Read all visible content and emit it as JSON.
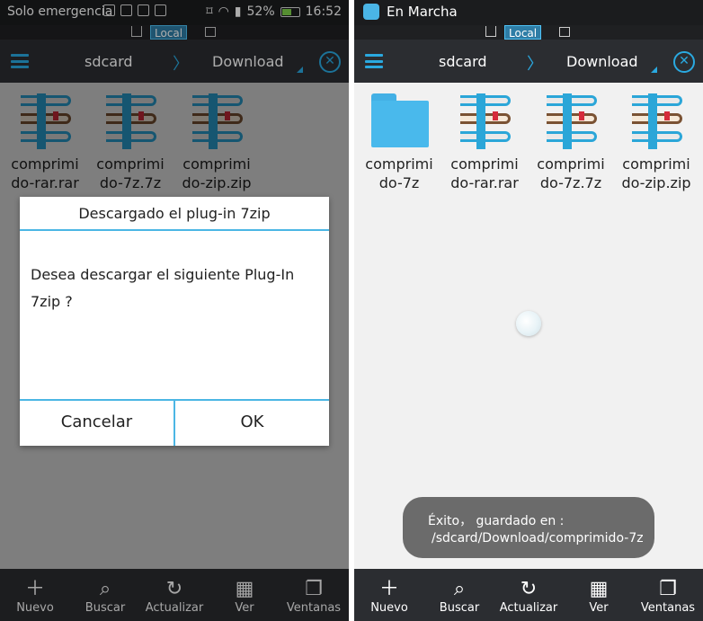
{
  "left": {
    "statusbar": {
      "text": "Solo emergencia",
      "battery": "52%",
      "time": "16:52"
    },
    "local_label": "Local",
    "toolbar": {
      "crumb1": "sdcard",
      "crumb2": "Download"
    },
    "files": [
      {
        "line1": "comprimi",
        "line2": "do-rar.rar",
        "icon": "archive-icon"
      },
      {
        "line1": "comprimi",
        "line2": "do-7z.7z",
        "icon": "archive-icon"
      },
      {
        "line1": "comprimi",
        "line2": "do-zip.zip",
        "icon": "archive-icon"
      }
    ],
    "dialog": {
      "title": "Descargado el plug-in 7zip",
      "message": "Desea descargar el siguiente Plug-In 7zip ?",
      "cancel": "Cancelar",
      "ok": "OK"
    }
  },
  "right": {
    "statusbar": {
      "text": "En Marcha"
    },
    "local_label": "Local",
    "toolbar": {
      "crumb1": "sdcard",
      "crumb2": "Download"
    },
    "files": [
      {
        "line1": "comprimi",
        "line2": "do-7z",
        "icon": "folder-icon"
      },
      {
        "line1": "comprimi",
        "line2": "do-rar.rar",
        "icon": "archive-icon"
      },
      {
        "line1": "comprimi",
        "line2": "do-7z.7z",
        "icon": "archive-icon"
      },
      {
        "line1": "comprimi",
        "line2": "do-zip.zip",
        "icon": "archive-icon"
      }
    ],
    "toast": {
      "line1": "Éxito， guardado en :",
      "line2": "/sdcard/Download/comprimido-7z"
    }
  },
  "bottombar": {
    "items": [
      "Nuevo",
      "Buscar",
      "Actualizar",
      "Ver",
      "Ventanas"
    ]
  },
  "colors": {
    "accent": "#2aa9e0",
    "toolbar": "#2b2d31",
    "statusbar": "#1b1c1e"
  }
}
